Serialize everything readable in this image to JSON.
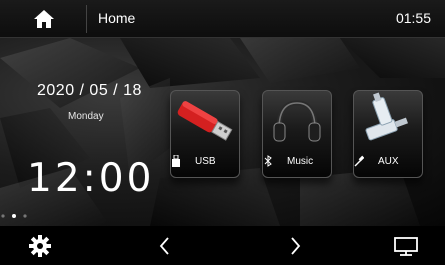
{
  "topbar": {
    "title": "Home",
    "time": "01:55",
    "home_icon": "home-icon"
  },
  "main": {
    "date": "2020 / 05 / 18",
    "weekday": "Monday",
    "time": "12:00"
  },
  "apps": [
    {
      "label": "USB",
      "icon": "usb-icon"
    },
    {
      "label": "Music",
      "icon": "bluetooth-icon"
    },
    {
      "label": "AUX",
      "icon": "aux-cable-icon"
    }
  ],
  "page_indicator": {
    "pages": 3,
    "current": 2
  },
  "bottombar": {
    "icons": [
      "gear-icon",
      "chevron-left-icon",
      "chevron-right-icon",
      "monitor-icon"
    ]
  },
  "colors": {
    "background": "#0a0a0a",
    "text": "#ffffff",
    "usb_red": "#d42020"
  }
}
